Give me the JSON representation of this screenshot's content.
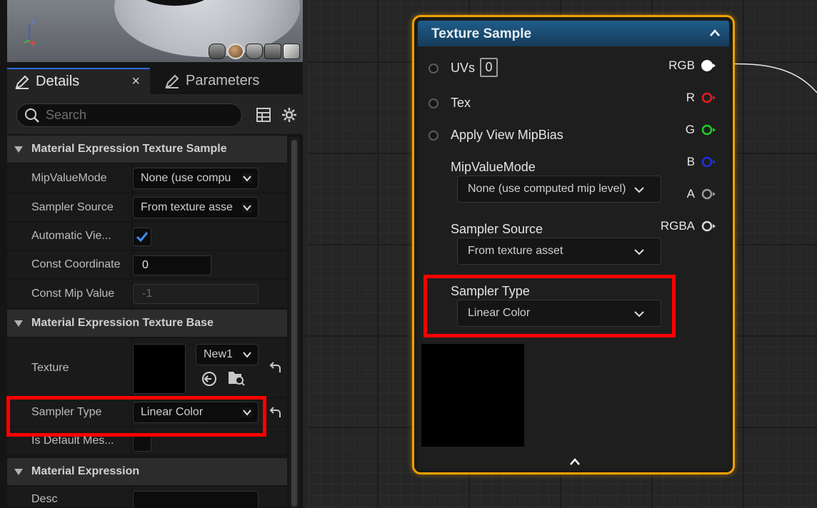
{
  "viewport": {
    "axis_labels": {
      "z": "z",
      "x": "x"
    },
    "preview_shapes": [
      "cylinder-icon",
      "sphere-icon",
      "plane-icon",
      "cube-icon",
      "custom-mesh-icon"
    ]
  },
  "tabs": {
    "details_label": "Details",
    "parameters_label": "Parameters",
    "close_glyph": "×"
  },
  "search": {
    "placeholder": "Search"
  },
  "details": {
    "categories": {
      "texture_sample": "Material Expression Texture Sample",
      "texture_base": "Material Expression Texture Base",
      "expression": "Material Expression"
    },
    "mip_value_mode": {
      "label": "MipValueMode",
      "value": "None (use compu"
    },
    "sampler_source": {
      "label": "Sampler Source",
      "value": "From texture asse"
    },
    "automatic_view": {
      "label": "Automatic Vie...",
      "checked": true
    },
    "const_coordinate": {
      "label": "Const Coordinate",
      "value": "0"
    },
    "const_mip_value": {
      "label": "Const Mip Value",
      "value": "-1"
    },
    "texture": {
      "label": "Texture",
      "asset_value": "New1"
    },
    "sampler_type": {
      "label": "Sampler Type",
      "value": "Linear Color"
    },
    "is_default_mesh": {
      "label": "Is Default Mes..."
    },
    "desc": {
      "label": "Desc"
    }
  },
  "node": {
    "title": "Texture Sample",
    "inputs": {
      "uvs": {
        "label": "UVs",
        "value": "0"
      },
      "tex": {
        "label": "Tex"
      },
      "apply_view_mipbias": {
        "label": "Apply View MipBias"
      }
    },
    "mip_value_mode": {
      "label": "MipValueMode",
      "value": "None (use computed mip level)"
    },
    "sampler_source": {
      "label": "Sampler Source",
      "value": "From texture asset"
    },
    "sampler_type": {
      "label": "Sampler Type",
      "value": "Linear Color"
    },
    "outputs": [
      {
        "label": "RGB",
        "color": "#ffffff"
      },
      {
        "label": "R",
        "color": "#e02020"
      },
      {
        "label": "G",
        "color": "#20d020"
      },
      {
        "label": "B",
        "color": "#2030e0"
      },
      {
        "label": "A",
        "color": "#9a9a9a"
      },
      {
        "label": "RGBA",
        "color": "#d8d8d8"
      }
    ]
  },
  "colors": {
    "highlight": "#ff0000",
    "node_border": "#f0a000",
    "node_header": "#1f5d8a",
    "accent_blue": "#2a6dd8"
  }
}
